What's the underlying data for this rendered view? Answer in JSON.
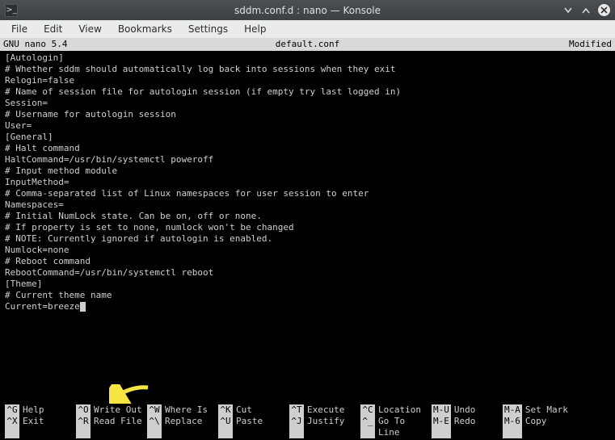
{
  "window": {
    "title": "sddm.conf.d : nano — Konsole",
    "icon_glyph": ">_"
  },
  "menubar": {
    "items": [
      "File",
      "Edit",
      "View",
      "Bookmarks",
      "Settings",
      "Help"
    ]
  },
  "nano_header": {
    "left": "GNU nano 5.4",
    "center": "default.conf",
    "right": "Modified"
  },
  "content_lines": [
    "[Autologin]",
    "# Whether sddm should automatically log back into sessions when they exit",
    "Relogin=false",
    "",
    "# Name of session file for autologin session (if empty try last logged in)",
    "Session=",
    "",
    "# Username for autologin session",
    "User=",
    "",
    "",
    "[General]",
    "# Halt command",
    "HaltCommand=/usr/bin/systemctl poweroff",
    "",
    "# Input method module",
    "InputMethod=",
    "",
    "# Comma-separated list of Linux namespaces for user session to enter",
    "Namespaces=",
    "",
    "# Initial NumLock state. Can be on, off or none.",
    "# If property is set to none, numlock won't be changed",
    "# NOTE: Currently ignored if autologin is enabled.",
    "Numlock=none",
    "",
    "# Reboot command",
    "RebootCommand=/usr/bin/systemctl reboot",
    "",
    "",
    "[Theme]",
    "# Current theme name",
    "Current=breeze"
  ],
  "shortcuts": {
    "row1": [
      {
        "key": "^G",
        "label": "Help"
      },
      {
        "key": "^O",
        "label": "Write Out"
      },
      {
        "key": "^W",
        "label": "Where Is"
      },
      {
        "key": "^K",
        "label": "Cut"
      },
      {
        "key": "^T",
        "label": "Execute"
      },
      {
        "key": "^C",
        "label": "Location"
      },
      {
        "key": "M-U",
        "label": "Undo"
      },
      {
        "key": "M-A",
        "label": "Set Mark"
      }
    ],
    "row2": [
      {
        "key": "^X",
        "label": "Exit"
      },
      {
        "key": "^R",
        "label": "Read File"
      },
      {
        "key": "^\\",
        "label": "Replace"
      },
      {
        "key": "^U",
        "label": "Paste"
      },
      {
        "key": "^J",
        "label": "Justify"
      },
      {
        "key": "^_",
        "label": "Go To Line"
      },
      {
        "key": "M-E",
        "label": "Redo"
      },
      {
        "key": "M-6",
        "label": "Copy"
      }
    ]
  },
  "annotation": {
    "arrow_color": "#f5e642"
  }
}
